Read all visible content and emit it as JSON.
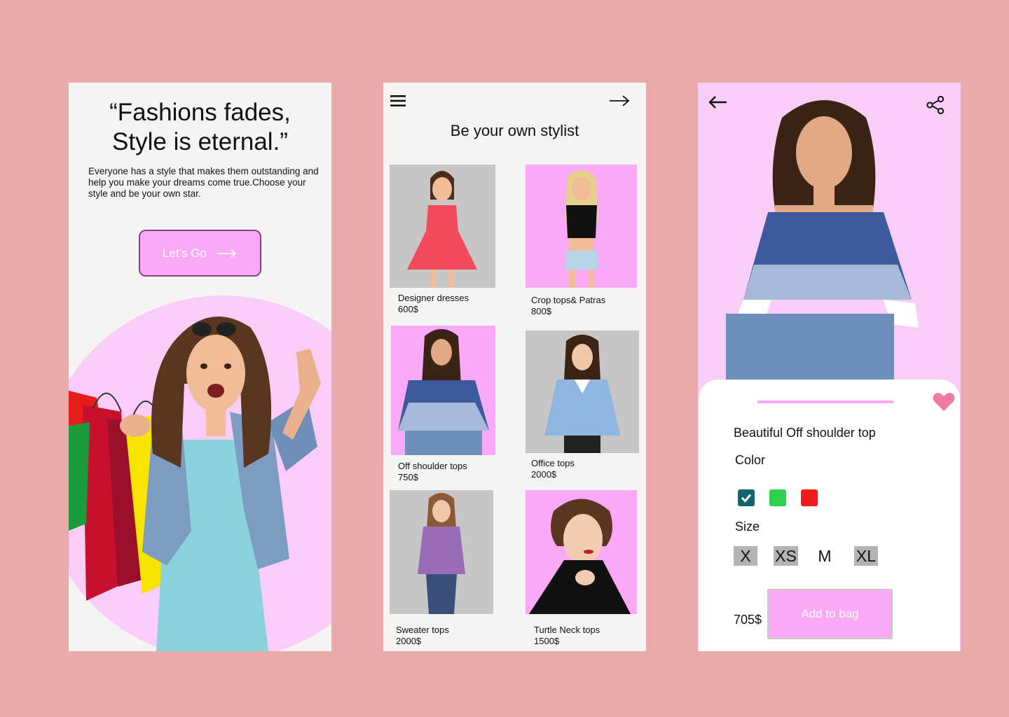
{
  "screen1": {
    "quote_line1": "“Fashions fades,",
    "quote_line2": "Style is eternal.”",
    "description": "Everyone has a style that makes them outstanding and help you make your dreams come true.Choose your style and be your own star.",
    "cta_label": "Let’s Go"
  },
  "screen2": {
    "title": "Be your own stylist",
    "products": [
      {
        "name": "Designer dresses",
        "price": "600$"
      },
      {
        "name": "Crop tops& Patras",
        "price": "800$"
      },
      {
        "name": "Off shoulder tops",
        "price": "750$"
      },
      {
        "name": "Office tops",
        "price": "2000$"
      },
      {
        "name": "Sweater tops",
        "price": "2000$"
      },
      {
        "name": "Turtle Neck tops",
        "price": "1500$"
      }
    ]
  },
  "screen3": {
    "product_name": "Beautiful Off shoulder top",
    "color_label": "Color",
    "colors": [
      "#12646e",
      "#2ed14a",
      "#f21b1b"
    ],
    "size_label": "Size",
    "sizes": [
      "X",
      "XS",
      "M",
      "XL"
    ],
    "price": "705$",
    "add_label": "Add to bag"
  },
  "theme": {
    "background": "#e8aaaa",
    "accent_pink": "#faa9f7",
    "light_pink": "#faccf8",
    "heart": "#f07aa0"
  }
}
